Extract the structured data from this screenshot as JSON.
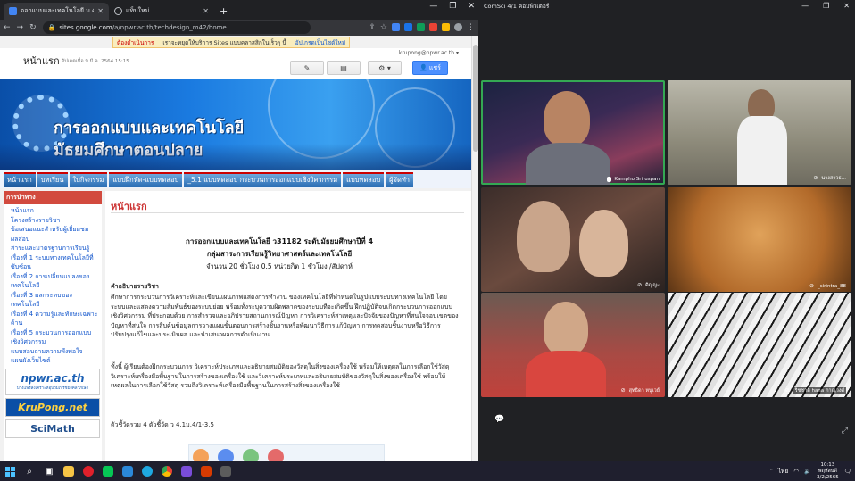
{
  "chrome": {
    "tabs": [
      {
        "title": "ออกแบบและเทคโนโลยี ม.4",
        "active": true
      },
      {
        "title": "แท็บใหม่",
        "active": false
      }
    ],
    "new_tab": "+",
    "url_domain": "sites.google.com",
    "url_path": "/a/npwr.ac.th/techdesign_m42/home",
    "min": "—",
    "max": "❐",
    "close": "✕"
  },
  "notice": {
    "status": "ต้องดำเนินการ",
    "message": "เราจะหยุดให้บริการ Sites แบบคลาสสิกในเร็วๆ นี้",
    "link": "อัปเกรดเป็นไซต์ใหม่"
  },
  "site_header": {
    "title": "หน้าแรก",
    "updated": "อัปเดตเมื่อ 9 มี.ค. 2564 15:15",
    "user": "krupong@npwr.ac.th ▾",
    "share": "แชร์"
  },
  "banner": {
    "line1": "การออกแบบและเทคโนโลยี",
    "line2": "มัธยมศึกษาตอนปลาย"
  },
  "nav": [
    "หน้าแรก",
    "บทเรียน",
    "ใบกิจกรรม",
    "แบบฝึกหัด-แบบทดสอบ",
    "_5.1 แบบทดสอบ กระบวนการออกแบบเชิงวิศวกรรม",
    "แบบทดสอบ",
    "ผู้จัดทำ"
  ],
  "sidebar": {
    "heading": "การนำทาง",
    "items": [
      "หน้าแรก",
      "โครงสร้างรายวิชา",
      "ข้อเสนอแนะสำหรับผู้เยี่ยมชม",
      "ผลสอบ",
      "สาระและมาตรฐานการเรียนรู้",
      "เรื่องที่ 1 ระบบทางเทคโนโลยีที่ซับซ้อน",
      "เรื่องที่ 2 การเปลี่ยนแปลงของเทคโนโลยี",
      "เรื่องที่ 3 ผลกระทบของเทคโนโลยี",
      "เรื่องที่ 4 ความรู้และทักษะเฉพาะด้าน",
      "เรื่องที่ 5 กระบวนการออกแบบเชิงวิศวกรรม",
      "แบบสอบถามความพึงพอใจ",
      "แผนผังเว็บไซต์"
    ],
    "logos": [
      "npwr.ac.th",
      "KruPong.net",
      "SciMath"
    ],
    "logo_sub": "บางแพร่สงเคราะห์อุปถัมภ์ รัชมังคลาภิเษก"
  },
  "content": {
    "heading": "หน้าแรก",
    "course_title": "การออกแบบและเทคโนโลยี  ว31182  ระดับมัธยมศึกษาปีที่ 4",
    "group": "กลุ่มสาระการเรียนรู้วิทยาศาสตร์และเทคโนโลยี",
    "hours": "จำนวน  20  ชั่วโมง     0.5  หน่วยกิต  1  ชั่วโมง /สัปดาห์",
    "desc_heading": "คำอธิบายรายวิชา",
    "para1": " ศึกษาการกระบวนการวิเคราะห์และเขียนแผนภาพแสดงการทำงาน ของเทคโนโลยีที่ทำหนดในรูปแบบระบบทางเทคโนโลยี โดยระบบและแสดงความสัมพันธ์ของระบบย่อย พร้อมทั้งระบุความผิดพลาดของระบบที่จะเกิดขึ้น ฝึกปฏิบัติจนเกิดกระบวนการออกแบบเชิงวิศวกรรม ที่ประกอบด้วย การสำรวจและอภิปรายสถานการณ์ปัญหา การวิเคราะห์สาเหตุและปัจจัยของปัญหาที่สนใจจอบเขตของปัญหาที่สนใจ การสืบค้นข้อมูลการวางแผนขั้นตอนการสร้างชิ้นงานหรือพัฒนาวิธีการแก้ปัญหา การทดสอบชิ้นงานหรือวิธีการปรับปรุงแก้ไขและประเมินผล และนำเสนอผลการดำเนินงาน",
    "para2": " ทั้งนี้ ผู้เรียนต้องฝึกกระบวนการ วิเคราะห์ประเภทและอธิบายสมบัติของวัสดุในสิ่งของเครื่องใช้ พร้อมให้เหตุผลในการเลือกใช้วัสดุ วิเคราะห์เครื่องมือพื้นฐานในการสร้างของเครื่องใช้ และวิเคราะห์ประเภทและอธิบายสมบัติของวัสดุในสิ่งของเครื่องใช้ พร้อมให้เหตุผลในการเลือกใช้วัสดุ รวมถึงวิเคราะห์เครื่องมือพื้นฐานในการสร้างสิ่งของเครื่องใช้",
    "indicators": "ตัวชี้วัดรวม  4  ตัวชี้วัด  ว 4.1ม.4/1-3,5"
  },
  "meet": {
    "title": "ComSci 4/1 คอมพิวเตอร์",
    "participants": [
      {
        "name": "Kampho Sriruspan",
        "speaking": true
      },
      {
        "name": "นางสาวธ...",
        "speaking": false
      },
      {
        "name": "ดิญญะ",
        "speaking": false
      },
      {
        "name": "_sirintra_88",
        "speaking": false
      },
      {
        "name": "สุทธิดา หนูเวย์",
        "speaking": false
      },
      {
        "name": "ริชชาติ hana ภาณุวงศ์",
        "speaking": false
      }
    ]
  },
  "taskbar": {
    "time": "10:13",
    "day": "พฤหัสบดี",
    "date": "3/2/2565",
    "lang": "ไทย"
  },
  "colors": {
    "speaking": "#34a853",
    "accent": "#4d90fe",
    "nav_border": "#cc0000"
  }
}
